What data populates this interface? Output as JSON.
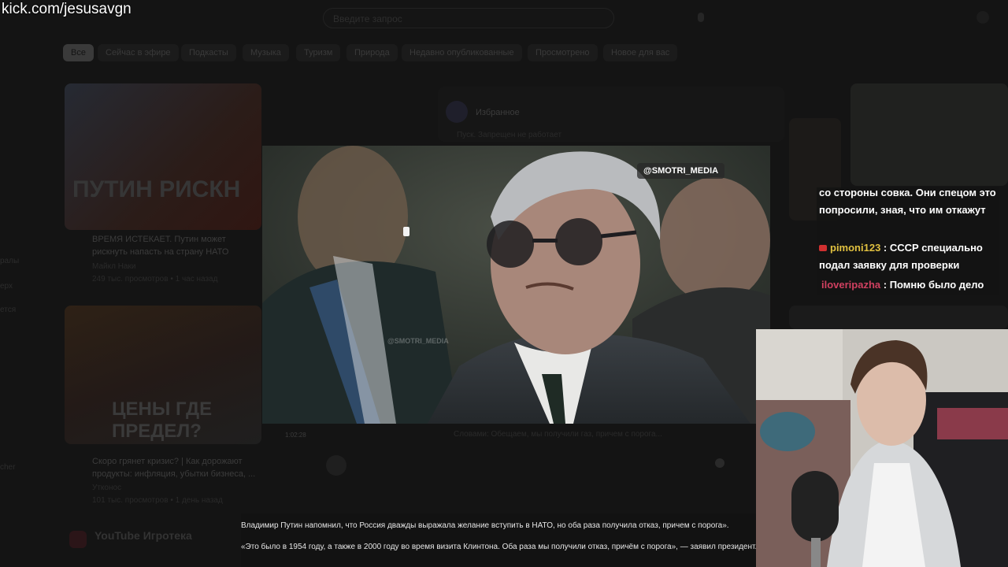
{
  "watermark": "kick.com/jesusavgn",
  "youtube": {
    "search_placeholder": "Введите запрос",
    "chips": [
      "Все",
      "Сейчас в эфире",
      "Подкасты",
      "Музыка",
      "Туризм",
      "Природа",
      "Недавно опубликованные",
      "Просмотрено",
      "Новое для вас"
    ],
    "sidebar": [
      "ралы",
      "ерх",
      "ется",
      "cher"
    ],
    "videos": [
      {
        "thumb_text": "ПУТИН РИСКН",
        "title": "ВРЕМЯ ИСТЕКАЕТ. Путин может рискнуть напасть на страну НАТО",
        "channel": "Майкл Наки",
        "meta": "249 тыс. просмотров • 1 час назад"
      },
      {
        "thumb_text": "ЦЕНЫ ГДЕ ПРЕДЕЛ?",
        "title": "Скоро грянет кризис? | Как дорожают продукты: инфляция, убытки бизнеса, ...",
        "channel": "Утконос",
        "meta": "101 тыс. просмотров • 1 день назад",
        "duration": "1:02:28"
      }
    ],
    "post": {
      "author": "Избранное",
      "text": "Пуск. Запрещен не работает"
    },
    "playables": "YouTube Игротека",
    "comments_text": "Словами: Обещаем, мы получили газ, причем с порога..."
  },
  "video": {
    "tag": "@SMOTRI_MEDIA",
    "inner_watermark": "@SMOTRI_MEDIA"
  },
  "article": {
    "line1": "Владимир Путин напомнил, что Россия дважды выражала желание вступить в НАТО, но оба раза получила отказ, причем с порога».",
    "line2": "«Это было в 1954 году, а также в 2000 году во время визита Клинтона. Оба раза мы получили отказ, причём с порога», — заявил президент."
  },
  "chat": {
    "messages": [
      {
        "user": "",
        "text": "со стороны совка. Они спецом это попросили, зная, что им откажут"
      },
      {
        "user": "pimoni123",
        "text": " : СССР специально подал заявку для проверки"
      },
      {
        "user": "iloveripazha",
        "text": " : Помню было дело"
      }
    ]
  }
}
